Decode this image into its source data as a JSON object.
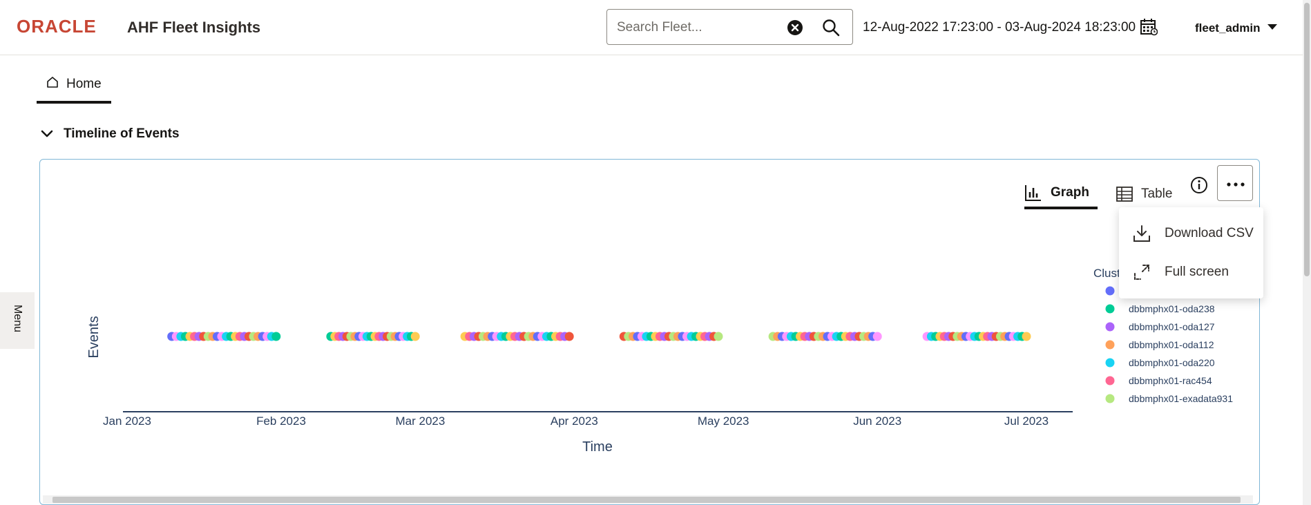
{
  "header": {
    "brand": "ORACLE",
    "app_title": "AHF Fleet Insights",
    "search_placeholder": "Search Fleet...",
    "date_range": "12-Aug-2022 17:23:00 - 03-Aug-2024 18:23:00",
    "user": "fleet_admin",
    "brand_color": "#C74634"
  },
  "tabs": [
    {
      "label": "Home",
      "icon": "home-icon",
      "active": true
    }
  ],
  "side_menu": {
    "label": "Menu"
  },
  "section": {
    "title": "Timeline of Events",
    "expanded": true
  },
  "view_toggle": {
    "graph_label": "Graph",
    "table_label": "Table",
    "active": "Graph"
  },
  "more_menu": {
    "open": true,
    "items": [
      {
        "label": "Download CSV",
        "icon": "download-icon"
      },
      {
        "label": "Full screen",
        "icon": "fullscreen-icon"
      }
    ]
  },
  "chart_data": {
    "type": "scatter",
    "ylabel": "Events",
    "xlabel": "Time",
    "x_ticks": [
      "Jan 2023",
      "Feb 2023",
      "Mar 2023",
      "Apr 2023",
      "May 2023",
      "Jun 2023",
      "Jul 2023"
    ],
    "grid": false,
    "legend": {
      "title": "Clust",
      "placement": "right",
      "entries": [
        {
          "name": "",
          "color": "#636EFA"
        },
        {
          "name": "dbbmphx01-oda238",
          "color": "#00CC96"
        },
        {
          "name": "dbbmphx01-oda127",
          "color": "#AB63FA"
        },
        {
          "name": "dbbmphx01-oda112",
          "color": "#FFA15A"
        },
        {
          "name": "dbbmphx01-oda220",
          "color": "#19D3F3"
        },
        {
          "name": "dbbmphx01-rac454",
          "color": "#FF6692"
        },
        {
          "name": "dbbmphx01-exadata931",
          "color": "#B6E880"
        },
        {
          "name": "",
          "color": "#FF97FF"
        }
      ]
    },
    "palette": [
      "#636EFA",
      "#00CC96",
      "#AB63FA",
      "#FFA15A",
      "#19D3F3",
      "#FF6692",
      "#B6E880",
      "#FF97FF",
      "#FECB52",
      "#EF553B"
    ],
    "event_groups": [
      {
        "start": "2023-01-10",
        "end": "2023-01-31",
        "count": 24
      },
      {
        "start": "2023-02-11",
        "end": "2023-02-28",
        "count": 22
      },
      {
        "start": "2023-03-10",
        "end": "2023-03-31",
        "count": 24
      },
      {
        "start": "2023-04-11",
        "end": "2023-04-30",
        "count": 22
      },
      {
        "start": "2023-05-11",
        "end": "2023-06-01",
        "count": 24
      },
      {
        "start": "2023-06-11",
        "end": "2023-07-01",
        "count": 24
      }
    ]
  }
}
